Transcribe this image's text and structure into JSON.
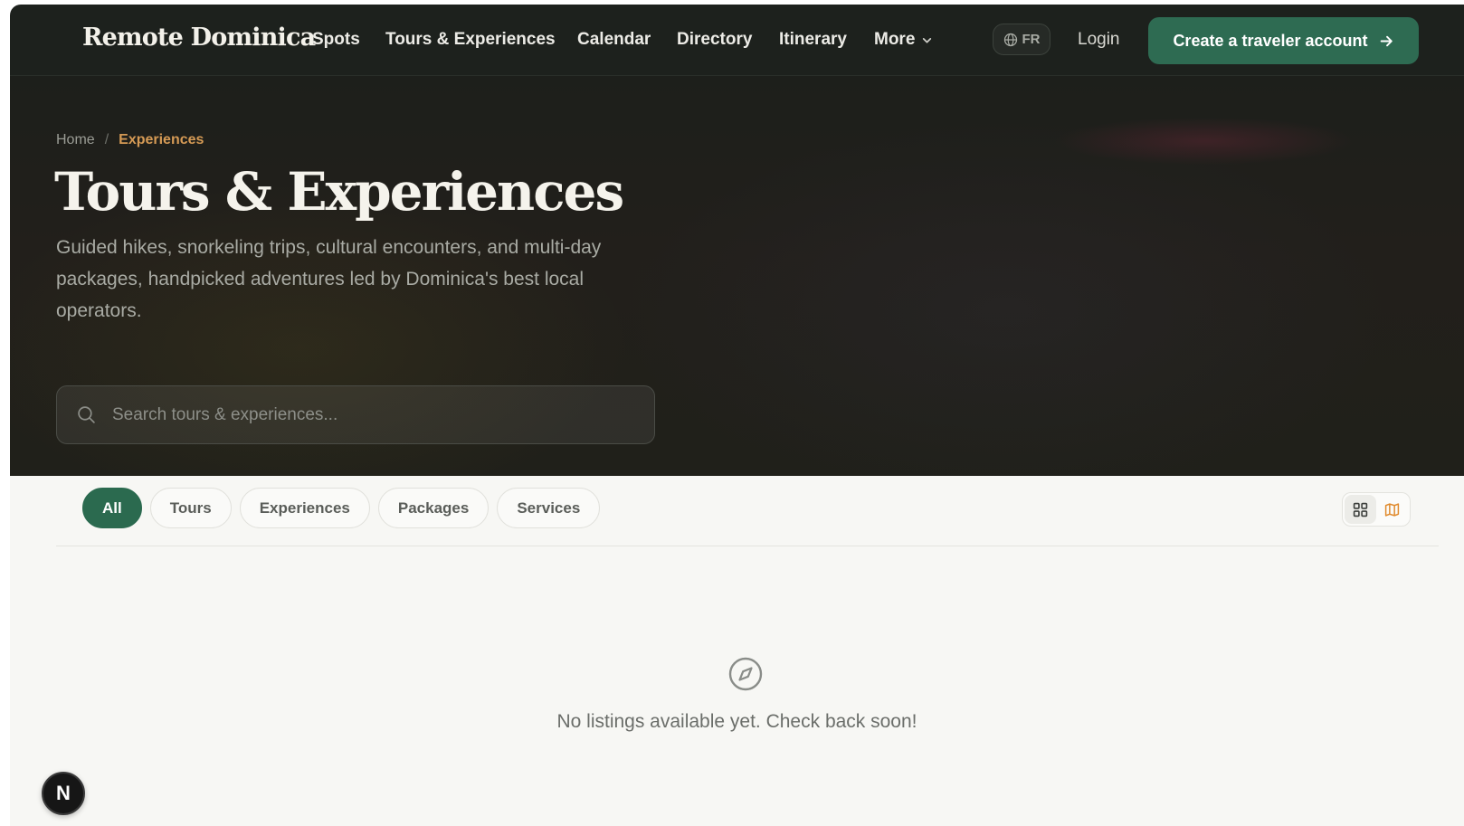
{
  "header": {
    "brand": "Remote Dominica",
    "nav": [
      {
        "label": "Spots"
      },
      {
        "label": "Tours & Experiences"
      },
      {
        "label": "Calendar"
      },
      {
        "label": "Directory"
      },
      {
        "label": "Itinerary"
      },
      {
        "label": "More"
      }
    ],
    "language": "FR",
    "login": "Login",
    "cta": "Create a traveler account"
  },
  "breadcrumb": {
    "home": "Home",
    "separator": "/",
    "current": "Experiences"
  },
  "hero": {
    "title": "Tours & Experiences",
    "subtitle": "Guided hikes, snorkeling trips, cultural encounters, and multi-day packages, handpicked adventures led by Dominica's best local operators."
  },
  "search": {
    "placeholder": "Search tours & experiences...",
    "value": ""
  },
  "filters": [
    {
      "label": "All",
      "active": true
    },
    {
      "label": "Tours",
      "active": false
    },
    {
      "label": "Experiences",
      "active": false
    },
    {
      "label": "Packages",
      "active": false
    },
    {
      "label": "Services",
      "active": false
    }
  ],
  "view_toggle": {
    "options": [
      "grid-icon",
      "map-icon"
    ],
    "selected": "grid-icon"
  },
  "empty_state": {
    "icon": "compass-icon",
    "message": "No listings available yet. Check back soon!"
  },
  "floating_badge": {
    "label": "N"
  },
  "colors": {
    "header_bg": "#1d211d",
    "accent_green": "#2e6b52",
    "breadcrumb_accent": "#d59a55",
    "map_icon": "#e08a2c"
  }
}
